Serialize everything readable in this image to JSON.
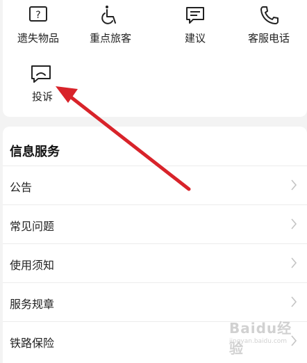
{
  "services": [
    {
      "label": "遗失物品",
      "icon": "question-box-icon"
    },
    {
      "label": "重点旅客",
      "icon": "wheelchair-icon"
    },
    {
      "label": "建议",
      "icon": "message-icon"
    },
    {
      "label": "客服电话",
      "icon": "phone-icon"
    },
    {
      "label": "投诉",
      "icon": "complaint-icon"
    }
  ],
  "info_section": {
    "title": "信息服务",
    "items": [
      {
        "label": "公告"
      },
      {
        "label": "常见问题"
      },
      {
        "label": "使用须知"
      },
      {
        "label": "服务规章"
      },
      {
        "label": "铁路保险"
      }
    ]
  },
  "watermark": {
    "text": "Baidu经验",
    "url": "jingyan.baidu.com"
  },
  "colors": {
    "arrow": "#d8232a",
    "icon": "#222222",
    "chevron": "#c4c4c4",
    "background": "#f3f3f3"
  }
}
